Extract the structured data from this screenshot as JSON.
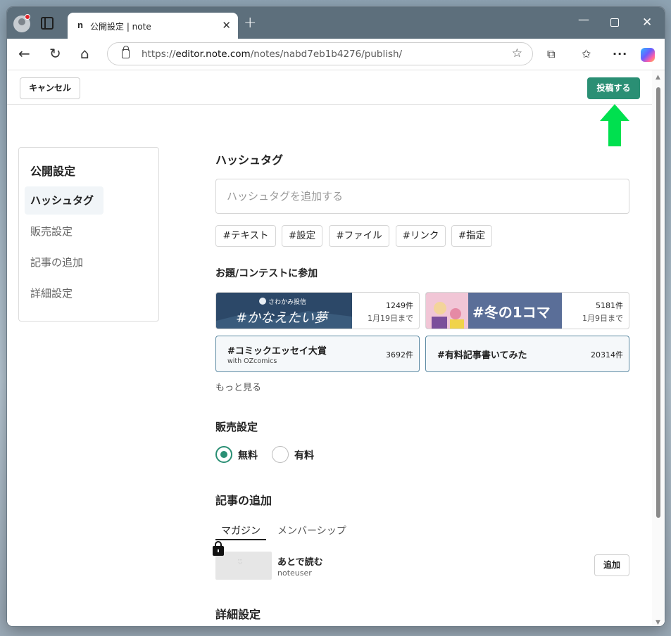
{
  "browser": {
    "tab_title": "公開設定 | note",
    "tab_favicon": "n",
    "url_prefix": "https://",
    "url_host": "editor.note.com",
    "url_path": "/notes/nabd7eb1b4276/publish/",
    "icons": [
      "profile-icon",
      "tab-actions-icon",
      "close-icon",
      "new-tab-icon",
      "back-icon",
      "reload-icon",
      "home-icon",
      "lock-icon",
      "star-icon",
      "extensions-icon",
      "favorites-icon",
      "more-icon",
      "copilot-icon"
    ]
  },
  "header": {
    "cancel_label": "キャンセル",
    "post_label": "投稿する",
    "accent_color": "#2a8f74",
    "arrow_color": "#00e04f"
  },
  "sidebar": {
    "title": "公開設定",
    "items": [
      {
        "label": "ハッシュタグ",
        "active": true
      },
      {
        "label": "販売設定",
        "active": false
      },
      {
        "label": "記事の追加",
        "active": false
      },
      {
        "label": "詳細設定",
        "active": false
      }
    ]
  },
  "hashtag": {
    "title": "ハッシュタグ",
    "placeholder": "ハッシュタグを追加する",
    "chips": [
      "#テキスト",
      "#設定",
      "#ファイル",
      "#リンク",
      "#指定"
    ]
  },
  "contest": {
    "title": "お題/コンテストに参加",
    "items": [
      {
        "banner_small": "さわかみ投信",
        "banner_text": "#かなえたい夢",
        "count": "1249件",
        "until": "1月19日まで"
      },
      {
        "banner_text": "#冬の1コマ",
        "count": "5181件",
        "until": "1月9日まで"
      },
      {
        "name": "#コミックエッセイ大賞",
        "sub": "with OZcomics",
        "count": "3692件"
      },
      {
        "name": "#有料記事書いてみた",
        "count": "20314件"
      }
    ],
    "more_label": "もっと見る"
  },
  "sales": {
    "title": "販売設定",
    "options": [
      {
        "label": "無料",
        "selected": true
      },
      {
        "label": "有料",
        "selected": false
      }
    ]
  },
  "add_article": {
    "title": "記事の追加",
    "tabs": [
      "マガジン",
      "メンバーシップ"
    ],
    "magazine": {
      "title": "あとで読む",
      "user": "noteuser",
      "add_label": "追加"
    }
  },
  "details": {
    "title": "詳細設定"
  }
}
